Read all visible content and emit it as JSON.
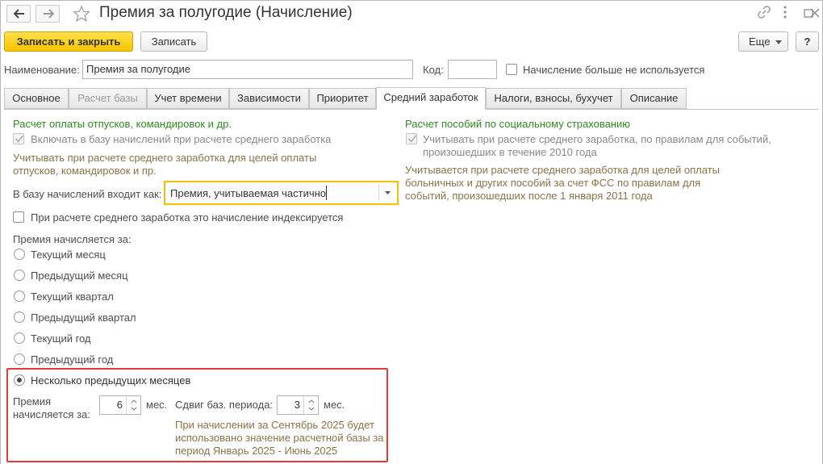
{
  "window": {
    "title": "Премия за полугодие (Начисление)"
  },
  "toolbar": {
    "save_close_label": "Записать и закрыть",
    "save_label": "Записать",
    "more_label": "Еще",
    "help_label": "?"
  },
  "header": {
    "name_label": "Наименование:",
    "name_value": "Премия за полугодие",
    "code_label": "Код:",
    "code_value": "",
    "unused_label": "Начисление больше не используется",
    "unused_checked": false
  },
  "tabs": [
    {
      "label": "Основное",
      "enabled": true
    },
    {
      "label": "Расчет базы",
      "enabled": false
    },
    {
      "label": "Учет времени",
      "enabled": true
    },
    {
      "label": "Зависимости",
      "enabled": true
    },
    {
      "label": "Приоритет",
      "enabled": true
    },
    {
      "label": "Средний заработок",
      "enabled": true,
      "active": true
    },
    {
      "label": "Налоги, взносы, бухучет",
      "enabled": true
    },
    {
      "label": "Описание",
      "enabled": true
    }
  ],
  "left": {
    "section_title": "Расчет оплаты отпусков, командировок и др.",
    "include_label": "Включать в базу начислений при расчете среднего заработка",
    "include_checked": true,
    "include_hint": "Учитывать при расчете среднего заработка для целей оплаты отпусков, командировок и пр.",
    "base_label": "В базу начислений входит как:",
    "base_value": "Премия, учитываемая частично",
    "indexed_label": "При расчете среднего заработка это начисление индексируется",
    "indexed_checked": false,
    "period_title": "Премия начисляется за:",
    "periods": [
      "Текущий месяц",
      "Предыдущий месяц",
      "Текущий квартал",
      "Предыдущий квартал",
      "Текущий год",
      "Предыдущий год",
      "Несколько предыдущих месяцев"
    ],
    "selected_period": "Несколько предыдущих месяцев",
    "months_label": "Премия начисляется за:",
    "months_value": "6",
    "months_unit": "мес.",
    "shift_label": "Сдвиг баз. периода:",
    "shift_value": "3",
    "shift_unit": "мес.",
    "note": "При начислении за Сентябрь 2025 будет использовано значение расчетной базы за период Январь 2025 - Июнь 2025"
  },
  "right": {
    "section_title": "Расчет пособий по социальному страхованию",
    "rules_label": "Учитывать при расчете среднего заработка, по правилам для событий, произошедших в течение 2010 года",
    "rules_checked": true,
    "hint": "Учитывается при расчете среднего заработка для целей оплаты больничных и других пособий за счет ФСС по правилам для событий, произошедших после 1 января 2011 года"
  },
  "colors": {
    "accent_yellow": "#f7c400",
    "section_green": "#2e8b1e",
    "highlight_red": "#e03a3a",
    "note_brown": "#8a7348"
  }
}
